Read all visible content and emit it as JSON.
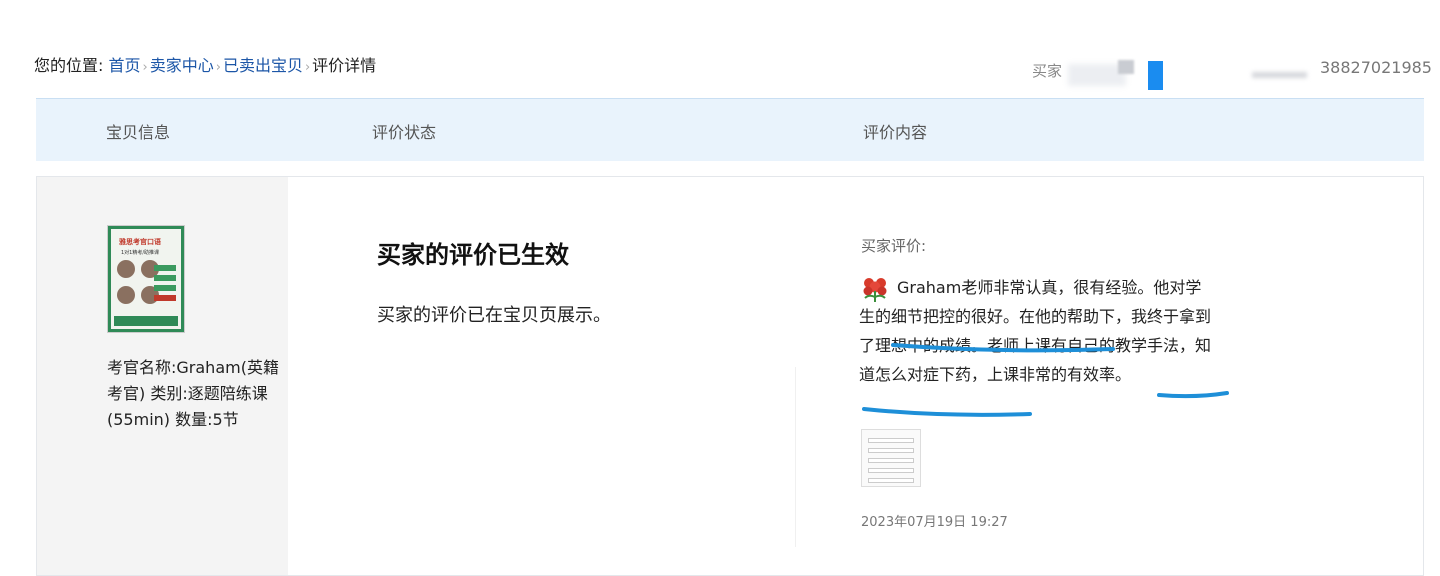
{
  "breadcrumb": {
    "prefix": "您的位置:",
    "items": [
      "首页",
      "卖家中心",
      "已卖出宝贝"
    ],
    "current": "评价详情"
  },
  "header": {
    "buyer_label": "买家",
    "phone_fragment": "38827021985"
  },
  "table": {
    "columns": [
      "宝贝信息",
      "评价状态",
      "评价内容"
    ]
  },
  "item": {
    "thumbnail_title": "雅思考官口语",
    "thumbnail_subtitle": "1对1精考/助推课",
    "description": "考官名称:Graham(英籍考官) 类别:逐题陪练课(55min) 数量:5节"
  },
  "status": {
    "title": "买家的评价已生效",
    "description": "买家的评价已在宝贝页展示。"
  },
  "review": {
    "label": "买家评价:",
    "text": "Graham老师非常认真，很有经验。他对学生的细节把控的很好。在他的帮助下，我终于拿到了理想中的成绩。老师上课有自己的教学手法，知道怎么对症下药，上课非常的有效率。",
    "date": "2023年07月19日 19:27",
    "annotation_color": "#1e8fd8"
  },
  "colors": {
    "link": "#1c56a7",
    "header_bg": "#e9f3fc",
    "left_col_bg": "#f4f4f4"
  }
}
